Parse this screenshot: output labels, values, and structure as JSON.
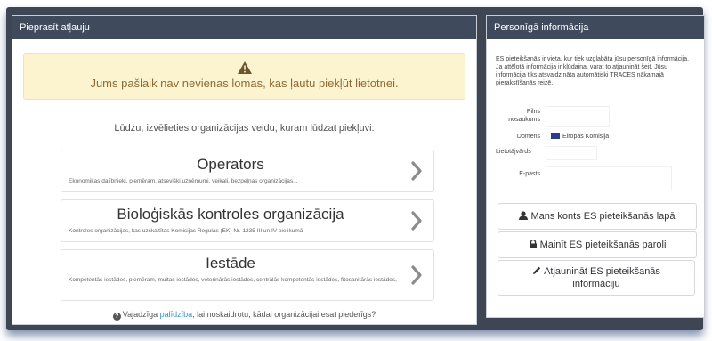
{
  "left_panel": {
    "title": "Pieprasīt atļauju",
    "alert": {
      "text": "Jums pašlaik nav nevienas lomas, kas ļautu piekļūt lietotnei.",
      "icon": "warning-icon",
      "color": "#8a6d3b",
      "background": "#fcf3cf"
    },
    "prompt": "Lūdzu, izvēlieties organizācijas veidu, kuram lūdzat piekļuvi:",
    "organizations": [
      {
        "title": "Operators",
        "description": "Ekonomikas dalībnieki, piemēram, atsevišķi uzņēmumi, veikali, bezpeļņas organizācijas..."
      },
      {
        "title": "Bioloģiskās kontroles organizācija",
        "description": "Kontroles organizācijas, kas uzskaitītas Komisijas Regulas (EK) Nr. 1235 III un IV pielikumā"
      },
      {
        "title": "Iestāde",
        "description": "Kompetentās iestādes, piemēram, muitas iestādes, veterinārās iestādes, centrālās kompetentās iestādes, fitosanitārās iestādes,"
      }
    ],
    "help": {
      "before": "Vajadzīga ",
      "link": "palīdzība",
      "after": ", lai noskaidrotu, kādai organizācijai esat piederīgs?"
    }
  },
  "right_panel": {
    "title": "Personīgā informācija",
    "info_text": "ES pieteikšanās ir vieta, kur tiek uzglabāta jūsu personīgā informācija. Ja attēlotā informācija ir kļūdaina, varat to atjaunināt šeit. Jūsu informācija tiks atsvaidzināta automātiski TRACES nākamajā pierakstīšanās reizē.",
    "fields": {
      "full_name_line1": "Pilns",
      "full_name_line2": "nosaukums",
      "domain_label": "Domēns",
      "domain_value": "Eiropas Komisija",
      "username_label": "Lietotājvārds",
      "email_label": "E-pasts"
    },
    "buttons": {
      "account": "Mans konts ES pieteikšanās lapā",
      "password": "Mainīt ES pieteikšanās paroli",
      "update_line1": "Atjaunināt ES pieteikšanās",
      "update_line2": "informāciju"
    }
  },
  "colors": {
    "header_bg": "#3f4a5c",
    "frame_bg": "#3e4654",
    "link": "#3a8fd8"
  }
}
